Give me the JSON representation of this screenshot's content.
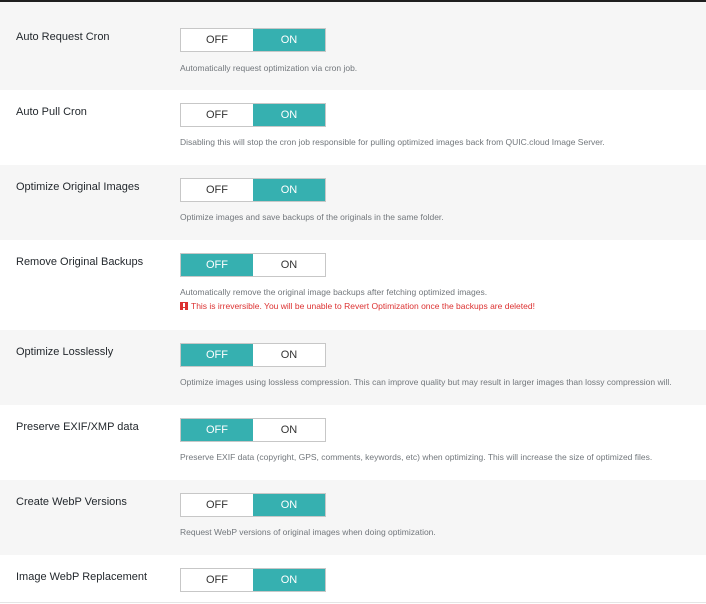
{
  "settings": [
    {
      "label": "Auto Request Cron",
      "off": "OFF",
      "on": "ON",
      "value": "on",
      "desc": "Automatically request optimization via cron job."
    },
    {
      "label": "Auto Pull Cron",
      "off": "OFF",
      "on": "ON",
      "value": "on",
      "desc": "Disabling this will stop the cron job responsible for pulling optimized images back from QUIC.cloud Image Server."
    },
    {
      "label": "Optimize Original Images",
      "off": "OFF",
      "on": "ON",
      "value": "on",
      "desc": "Optimize images and save backups of the originals in the same folder."
    },
    {
      "label": "Remove Original Backups",
      "off": "OFF",
      "on": "ON",
      "value": "off",
      "desc": "Automatically remove the original image backups after fetching optimized images.",
      "warning": "This is irreversible. You will be unable to Revert Optimization once the backups are deleted!"
    },
    {
      "label": "Optimize Losslessly",
      "off": "OFF",
      "on": "ON",
      "value": "off",
      "desc": "Optimize images using lossless compression. This can improve quality but may result in larger images than lossy compression will."
    },
    {
      "label": "Preserve EXIF/XMP data",
      "off": "OFF",
      "on": "ON",
      "value": "off",
      "desc": "Preserve EXIF data (copyright, GPS, comments, keywords, etc) when optimizing. This will increase the size of optimized files."
    },
    {
      "label": "Create WebP Versions",
      "off": "OFF",
      "on": "ON",
      "value": "on",
      "desc": "Request WebP versions of original images when doing optimization."
    },
    {
      "label": "Image WebP Replacement",
      "off": "OFF",
      "on": "ON",
      "value": "on"
    }
  ],
  "colors": {
    "accent": "#36b0b0",
    "warning": "#dc3232",
    "row_alt": "#f6f6f6"
  }
}
